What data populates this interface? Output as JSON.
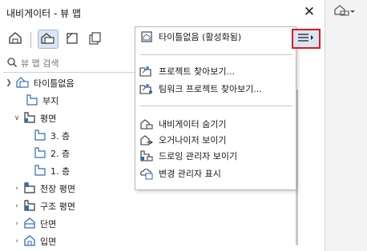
{
  "window": {
    "title": "내비게이터 - 뷰 맵"
  },
  "search": {
    "placeholder": "뷰 맵 검색"
  },
  "toolbar": {
    "buttons": [
      {
        "icon": "project-map-icon",
        "active": false
      },
      {
        "icon": "view-map-icon",
        "active": true
      },
      {
        "icon": "layout-book-icon",
        "active": false
      },
      {
        "icon": "publisher-sets-icon",
        "active": false
      }
    ]
  },
  "tree": {
    "items": [
      {
        "label": "타이틀없음",
        "icon": "view-map-root-icon"
      },
      {
        "label": "부지",
        "icon": "folder-icon"
      },
      {
        "label": "평면",
        "icon": "floor-plan-icon"
      },
      {
        "label": "3. 층",
        "icon": "folder-icon"
      },
      {
        "label": "2. 층",
        "icon": "folder-icon"
      },
      {
        "label": "1. 층",
        "icon": "folder-icon"
      },
      {
        "label": "천장 평면",
        "icon": "ceiling-plan-icon"
      },
      {
        "label": "구조 평면",
        "icon": "structural-plan-icon"
      },
      {
        "label": "단면",
        "icon": "section-icon"
      },
      {
        "label": "입면",
        "icon": "elevation-icon"
      }
    ]
  },
  "menu": {
    "header": "타이틀없음 (활성화됨)",
    "items": [
      {
        "label": "프로젝트 찾아보기...",
        "icon": "open-project-icon"
      },
      {
        "label": "팀워크 프로젝트 찾아보기...",
        "icon": "open-teamwork-project-icon"
      },
      {
        "label": "내비게이터 숨기기",
        "icon": "hide-navigator-icon"
      },
      {
        "label": "오거나이저 보이기",
        "icon": "organizer-icon"
      },
      {
        "label": "드로잉 관리자 보이기",
        "icon": "drawing-manager-icon"
      },
      {
        "label": "변경 관리자 표시",
        "icon": "change-manager-icon"
      }
    ]
  },
  "colors": {
    "highlight_border": "#e8161b",
    "active_bg": "#d8e6f5",
    "icon_blue": "#2f6db5"
  }
}
